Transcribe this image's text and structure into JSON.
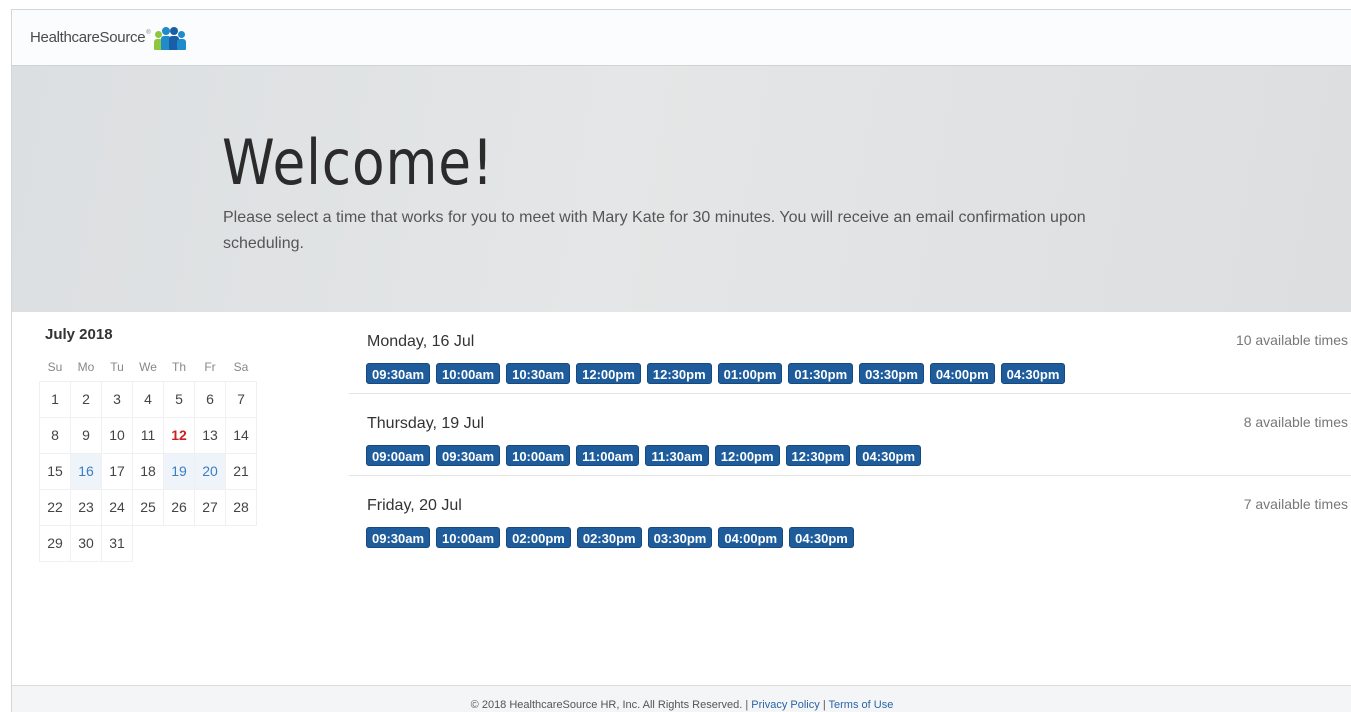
{
  "header": {
    "logo_text": "HealthcareSource",
    "logo_tm": "®",
    "brand_colors": [
      "#8dc63f",
      "#1e8bcb",
      "#1a5ea8"
    ]
  },
  "hero": {
    "title": "Welcome!",
    "message": "Please select a time that works for you to meet with Mary Kate for 30 minutes. You will receive an email confirmation upon scheduling."
  },
  "calendar": {
    "month_label": "July 2018",
    "weekdays": [
      "Su",
      "Mo",
      "Tu",
      "We",
      "Th",
      "Fr",
      "Sa"
    ],
    "weeks": [
      [
        "1",
        "2",
        "3",
        "4",
        "5",
        "6",
        "7"
      ],
      [
        "8",
        "9",
        "10",
        "11",
        "12",
        "13",
        "14"
      ],
      [
        "15",
        "16",
        "17",
        "18",
        "19",
        "20",
        "21"
      ],
      [
        "22",
        "23",
        "24",
        "25",
        "26",
        "27",
        "28"
      ],
      [
        "29",
        "30",
        "31",
        "",
        "",
        "",
        ""
      ]
    ],
    "today": "12",
    "available_days": [
      "16",
      "19",
      "20"
    ]
  },
  "days": [
    {
      "title": "Monday, 16 Jul",
      "count": "10 available times",
      "slots": [
        "09:30am",
        "10:00am",
        "10:30am",
        "12:00pm",
        "12:30pm",
        "01:00pm",
        "01:30pm",
        "03:30pm",
        "04:00pm",
        "04:30pm"
      ]
    },
    {
      "title": "Thursday, 19 Jul",
      "count": "8 available times",
      "slots": [
        "09:00am",
        "09:30am",
        "10:00am",
        "11:00am",
        "11:30am",
        "12:00pm",
        "12:30pm",
        "04:30pm"
      ]
    },
    {
      "title": "Friday, 20 Jul",
      "count": "7 available times",
      "slots": [
        "09:30am",
        "10:00am",
        "02:00pm",
        "02:30pm",
        "03:30pm",
        "04:00pm",
        "04:30pm"
      ]
    }
  ],
  "footer": {
    "copyright": "© 2018 HealthcareSource HR, Inc. All Rights Reserved. |",
    "privacy": "Privacy Policy",
    "separator": "|",
    "terms": "Terms of Use"
  }
}
